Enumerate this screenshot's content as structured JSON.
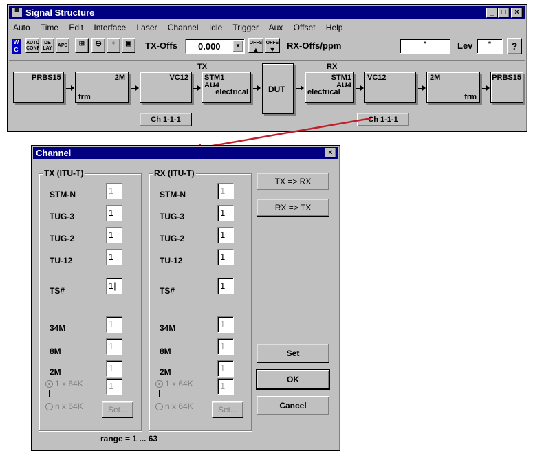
{
  "main_window": {
    "title": "Signal Structure",
    "menu": [
      "Auto",
      "Time",
      "Edit",
      "Interface",
      "Laser",
      "Channel",
      "Idle",
      "Trigger",
      "Aux",
      "Offset",
      "Help"
    ],
    "toolbar": {
      "app_icon": "WG",
      "auto_conf": "AUTO CONF",
      "delay": "DE LAY",
      "aps": "APS",
      "tx_offs_label": "TX-Offs",
      "tx_offs_value": "0.000",
      "offs_up": "OFFS",
      "offs_down": "OFFS",
      "rx_offs_label": "RX-Offs/ppm",
      "rx_offs_value": "*",
      "lev_label": "Lev",
      "lev_value": "*",
      "help_icon": "?"
    },
    "chain": {
      "tx_label": "TX",
      "rx_label": "RX",
      "prbs_tx": "PRBS15",
      "m2_tx_top": "2M",
      "m2_tx_bottom": "frm",
      "vc12_tx": "VC12",
      "stm_tx_1": "STM1",
      "stm_tx_2": "AU4",
      "stm_tx_3": "electrical",
      "dut": "DUT",
      "stm_rx_1": "STM1",
      "stm_rx_2": "AU4",
      "stm_rx_3": "electrical",
      "vc12_rx": "VC12",
      "m2_rx_top": "2M",
      "m2_rx_bottom": "frm",
      "prbs_rx": "PRBS15",
      "ch_tx": "Ch 1-1-1",
      "ch_rx": "Ch 1-1-1"
    }
  },
  "channel_dialog": {
    "title": "Channel",
    "close": "×",
    "tx_group": "TX (ITU-T)",
    "rx_group": "RX (ITU-T)",
    "rows": {
      "stm_n": "STM-N",
      "tug3": "TUG-3",
      "tug2": "TUG-2",
      "tu12": "TU-12",
      "ts": "TS#",
      "m34": "34M",
      "m8": "8M",
      "m2": "2M"
    },
    "tx_values": {
      "stm_n": "1",
      "tug3": "1",
      "tug2": "1",
      "tu12": "1",
      "ts": "1",
      "m34": "1",
      "m8": "1",
      "m2": "1",
      "k64": "1"
    },
    "rx_values": {
      "stm_n": "1",
      "tug3": "1",
      "tug2": "1",
      "tu12": "1",
      "ts": "1",
      "m34": "1",
      "m8": "1",
      "m2": "1",
      "k64": "1"
    },
    "radio_1x64": "1 x 64K",
    "radio_nx64": "n x 64K",
    "set_small": "Set...",
    "tx_to_rx": "TX => RX",
    "rx_to_tx": "RX => TX",
    "set": "Set",
    "ok": "OK",
    "cancel": "Cancel",
    "range": "range = 1 ... 63"
  },
  "colors": {
    "titlebar": "#000080",
    "face": "#c0c0c0",
    "arrow": "#c0202a"
  }
}
